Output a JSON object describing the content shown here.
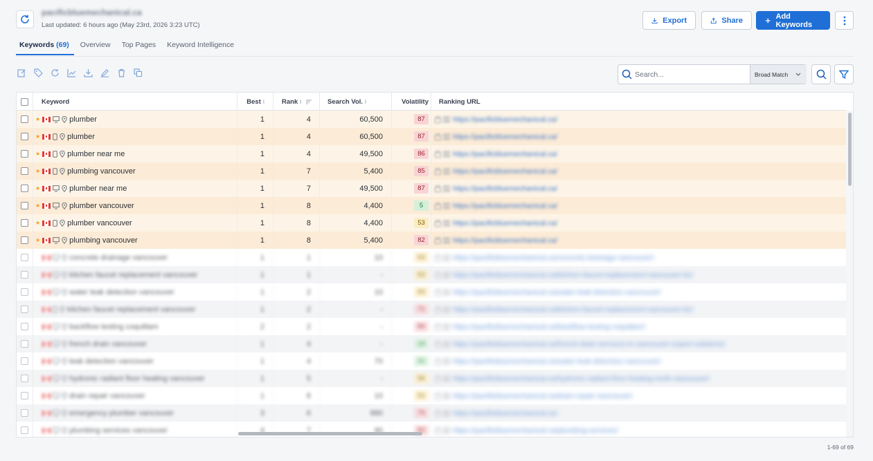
{
  "header": {
    "site_name": "pacificbluemechanical.ca",
    "last_updated": "Last updated: 6 hours ago (May 23rd, 2026 3:23 UTC)",
    "export_label": "Export",
    "share_label": "Share",
    "add_label": "Add Keywords"
  },
  "tabs": [
    {
      "label": "Keywords",
      "count": "(69)"
    },
    {
      "label": "Overview"
    },
    {
      "label": "Top Pages"
    },
    {
      "label": "Keyword Intelligence"
    }
  ],
  "search": {
    "placeholder": "Search...",
    "match_type": "Broad Match"
  },
  "table": {
    "headers": {
      "keyword": "Keyword",
      "best": "Best",
      "rank": "Rank",
      "volume": "Search Vol.",
      "volatility": "Volatility",
      "url": "Ranking URL",
      "info_mark": "i"
    },
    "rows": [
      {
        "keyword": "plumber",
        "device": "desktop",
        "best": "1",
        "rank": "4",
        "volume": "60,500",
        "volatility": "87",
        "vclass": "v-red",
        "url": "https://pacificbluemechanical.ca/",
        "starred": true
      },
      {
        "keyword": "plumber",
        "device": "mobile",
        "best": "1",
        "rank": "4",
        "volume": "60,500",
        "volatility": "87",
        "vclass": "v-red",
        "url": "https://pacificbluemechanical.ca/",
        "starred": true
      },
      {
        "keyword": "plumber near me",
        "device": "mobile",
        "best": "1",
        "rank": "4",
        "volume": "49,500",
        "volatility": "86",
        "vclass": "v-red",
        "url": "https://pacificbluemechanical.ca/",
        "starred": true
      },
      {
        "keyword": "plumbing vancouver",
        "device": "mobile",
        "best": "1",
        "rank": "7",
        "volume": "5,400",
        "volatility": "85",
        "vclass": "v-red",
        "url": "https://pacificbluemechanical.ca/",
        "starred": true
      },
      {
        "keyword": "plumber near me",
        "device": "desktop",
        "best": "1",
        "rank": "7",
        "volume": "49,500",
        "volatility": "87",
        "vclass": "v-red",
        "url": "https://pacificbluemechanical.ca/",
        "starred": true
      },
      {
        "keyword": "plumber vancouver",
        "device": "desktop",
        "best": "1",
        "rank": "8",
        "volume": "4,400",
        "volatility": "5",
        "vclass": "v-green",
        "url": "https://pacificbluemechanical.ca/",
        "starred": true
      },
      {
        "keyword": "plumber vancouver",
        "device": "mobile",
        "best": "1",
        "rank": "8",
        "volume": "4,400",
        "volatility": "53",
        "vclass": "v-yellow",
        "url": "https://pacificbluemechanical.ca/",
        "starred": true
      },
      {
        "keyword": "plumbing vancouver",
        "device": "desktop",
        "best": "1",
        "rank": "8",
        "volume": "5,400",
        "volatility": "82",
        "vclass": "v-red",
        "url": "https://pacificbluemechanical.ca/",
        "starred": true
      },
      {
        "keyword": "concrete drainage vancouver",
        "device": "desktop",
        "best": "1",
        "rank": "1",
        "volume": "10",
        "volatility": "53",
        "vclass": "v-yellow",
        "url": "https://pacificbluemechanical.ca/concrete-drainage-vancouver/",
        "dim": true
      },
      {
        "keyword": "kitchen faucet replacement vancouver",
        "device": "desktop",
        "best": "1",
        "rank": "1",
        "volume": "-",
        "volatility": "53",
        "vclass": "v-yellow",
        "url": "https://pacificbluemechanical.ca/kitchen-faucet-replacement-vancouver-bc/",
        "dim": true
      },
      {
        "keyword": "water leak detection vancouver",
        "device": "desktop",
        "best": "1",
        "rank": "2",
        "volume": "10",
        "volatility": "50",
        "vclass": "v-yellow",
        "url": "https://pacificbluemechanical.ca/water-leak-detection-vancouver/",
        "dim": true
      },
      {
        "keyword": "kitchen faucet replacement vancouver",
        "device": "mobile",
        "best": "1",
        "rank": "2",
        "volume": "-",
        "volatility": "71",
        "vclass": "v-red",
        "url": "https://pacificbluemechanical.ca/kitchen-faucet-replacement-vancouver-bc/",
        "dim": true
      },
      {
        "keyword": "backflow testing coquitlam",
        "device": "desktop",
        "best": "2",
        "rank": "2",
        "volume": "-",
        "volatility": "86",
        "vclass": "v-red",
        "url": "https://pacificbluemechanical.ca/backflow-testing-coquitlam/",
        "dim": true
      },
      {
        "keyword": "french drain vancouver",
        "device": "desktop",
        "best": "1",
        "rank": "4",
        "volume": "-",
        "volatility": "19",
        "vclass": "v-green",
        "url": "https://pacificbluemechanical.ca/french-drain-services-in-vancouver-expert-solutions/",
        "dim": true
      },
      {
        "keyword": "leak detection vancouver",
        "device": "desktop",
        "best": "1",
        "rank": "4",
        "volume": "70",
        "volatility": "31",
        "vclass": "v-green",
        "url": "https://pacificbluemechanical.ca/water-leak-detection-vancouver/",
        "dim": true
      },
      {
        "keyword": "hydronic radiant floor heating vancouver",
        "device": "desktop",
        "best": "1",
        "rank": "5",
        "volume": "-",
        "volatility": "56",
        "vclass": "v-yellow",
        "url": "https://pacificbluemechanical.ca/hydronic-radiant-floor-heating-north-vancouver/",
        "dim": true
      },
      {
        "keyword": "drain repair vancouver",
        "device": "desktop",
        "best": "1",
        "rank": "6",
        "volume": "10",
        "volatility": "51",
        "vclass": "v-yellow",
        "url": "https://pacificbluemechanical.ca/drain-repair-vancouver/",
        "dim": true
      },
      {
        "keyword": "emergency plumber vancouver",
        "device": "desktop",
        "best": "3",
        "rank": "6",
        "volume": "880",
        "volatility": "75",
        "vclass": "v-red",
        "url": "https://pacificbluemechanical.ca/",
        "dim": true
      },
      {
        "keyword": "plumbing services vancouver",
        "device": "desktop",
        "best": "4",
        "rank": "7",
        "volume": "90",
        "volatility": "82",
        "vclass": "v-red",
        "url": "https://pacificbluemechanical.ca/plumbing-services/",
        "dim": true
      }
    ]
  },
  "pagination": "1-69 of 69",
  "colors": {
    "accent": "#1f6fd6",
    "highlight_row": "#fdf4e7"
  }
}
